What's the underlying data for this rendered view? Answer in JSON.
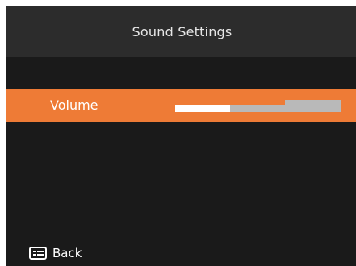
{
  "header": {
    "title": "Sound Settings"
  },
  "menu": {
    "items": [
      {
        "label": "Volume",
        "selected": true,
        "level": 0.33
      }
    ]
  },
  "footer": {
    "back_label": "Back",
    "back_icon": "menu-list-icon"
  },
  "colors": {
    "screen_background": "#1a1a1a",
    "header_background": "#2c2c2c",
    "selection_highlight": "#ee7b36",
    "slider_fill": "#ffffff",
    "slider_track": "#b9b9b9"
  }
}
